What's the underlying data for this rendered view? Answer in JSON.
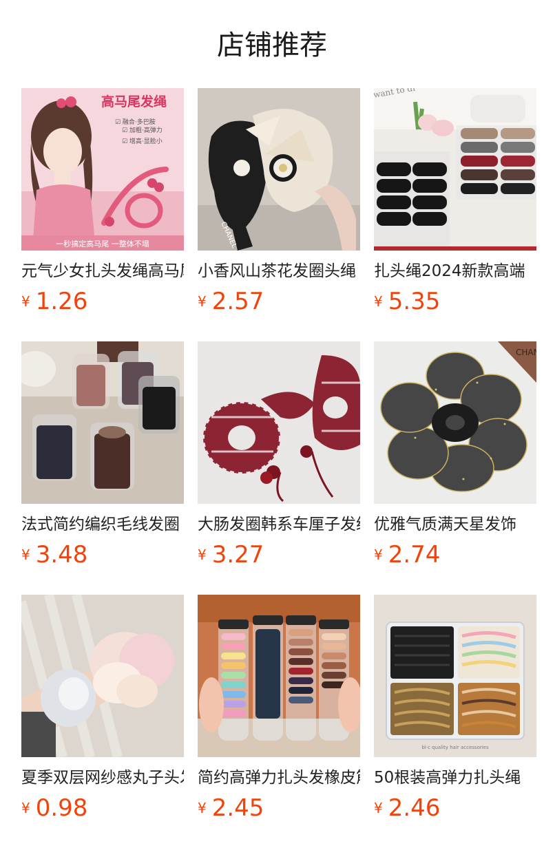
{
  "section": {
    "title": "店铺推荐"
  },
  "currency_symbol": "¥",
  "products": [
    {
      "name": "元气少女扎头发绳高马尾",
      "price": "1.26",
      "image_icon": "pink-ponytail-hair-tie-image",
      "image_text": {
        "headline": "高马尾发绳",
        "features": [
          "☑ 融合·多巴胺",
          "☑ 加粗·高弹力",
          "☑ 增高·显脸小"
        ],
        "banner": "一秒搞定高马尾   一整体不塌"
      }
    },
    {
      "name": "小香风山茶花发圈头绳",
      "price": "2.57",
      "image_icon": "camellia-scrunchie-image",
      "image_text": {
        "ribbon": "CHANEL"
      }
    },
    {
      "name": "扎头绳2024新款高端",
      "price": "5.35",
      "image_icon": "hair-tie-box-image",
      "image_text": {
        "card": "want to dr"
      }
    },
    {
      "name": "法式简约编织毛线发圈",
      "price": "3.48",
      "image_icon": "jarred-hair-ties-image"
    },
    {
      "name": "大肠发圈韩系车厘子发绳",
      "price": "3.27",
      "image_icon": "cherry-plaid-scrunchie-image"
    },
    {
      "name": "优雅气质满天星发饰",
      "price": "2.74",
      "image_icon": "black-organza-scrunchie-image",
      "image_text": {
        "tag": "CHAN"
      }
    },
    {
      "name": "夏季双层网纱感丸子头发圈",
      "price": "0.98",
      "image_icon": "organza-scrunchie-wrist-image"
    },
    {
      "name": "简约高弹力扎头发橡皮筋",
      "price": "2.45",
      "image_icon": "hair-tie-tubes-image"
    },
    {
      "name": "50根装高弹力扎头绳",
      "price": "2.46",
      "image_icon": "braided-hair-ties-box-image",
      "image_text": {
        "caption": "bl·c  quality  hair  accessories"
      }
    }
  ]
}
